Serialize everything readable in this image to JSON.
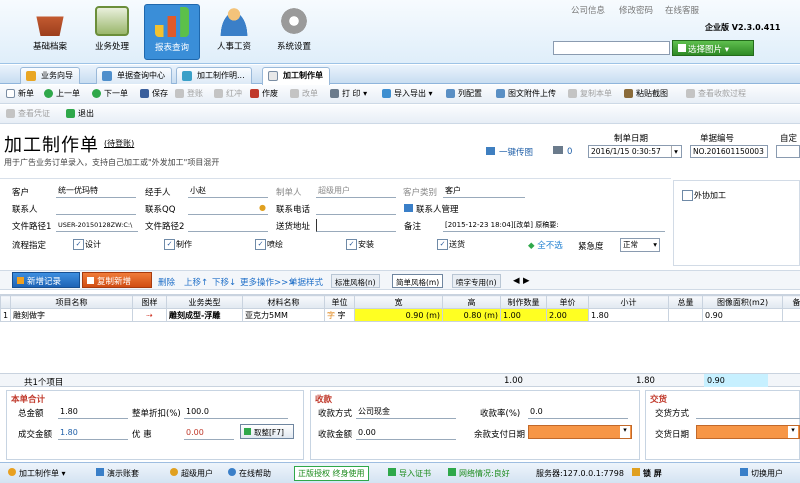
{
  "header": {
    "nav": [
      {
        "label": "基础档案",
        "icon": "basket-icon",
        "color": "#b5542f"
      },
      {
        "label": "业务处理",
        "icon": "calculator-icon",
        "color": "#6b8e3a"
      },
      {
        "label": "报表查询",
        "icon": "bar-chart-icon",
        "color": "#e0a020"
      },
      {
        "label": "人事工资",
        "icon": "person-icon",
        "color": "#3a7fc8"
      },
      {
        "label": "系统设置",
        "icon": "gear-icon",
        "color": "#8a8a8a"
      }
    ],
    "links": [
      "公司信息",
      "修改密码",
      "在线客服"
    ],
    "edition": "企业版 V2.3.0.411",
    "select_image_label": "选择图片"
  },
  "tabs": [
    "业务向导",
    "单据查询中心",
    "加工制作明...",
    "加工制作单"
  ],
  "toolbar1": [
    {
      "label": "新单",
      "enabled": true
    },
    {
      "label": "上一单",
      "enabled": true
    },
    {
      "label": "下一单",
      "enabled": true
    },
    {
      "label": "保存",
      "enabled": true
    },
    {
      "label": "登账",
      "enabled": false
    },
    {
      "label": "红冲",
      "enabled": false
    },
    {
      "label": "作废",
      "enabled": true
    },
    {
      "label": "改单",
      "enabled": false
    },
    {
      "label": "打 印",
      "enabled": true
    },
    {
      "label": "导入导出",
      "enabled": true
    },
    {
      "label": "列配置",
      "enabled": true
    },
    {
      "label": "图文附件上传",
      "enabled": true
    },
    {
      "label": "复制本单",
      "enabled": false
    },
    {
      "label": "粘贴截图",
      "enabled": true
    },
    {
      "label": "查看收款过程",
      "enabled": false
    }
  ],
  "toolbar2": [
    {
      "label": "查看凭证",
      "enabled": false
    },
    {
      "label": "退出",
      "enabled": true
    }
  ],
  "doc": {
    "title": "加工制作单",
    "status": "(待登账)",
    "subtitle": "用于广告业务订单录入，支持自己加工或\"外发加工\"项目混开",
    "upload_label": "一键传图",
    "print_count": "0",
    "date_label": "制单日期",
    "date_value": "2016/1/15 0:30:57",
    "number_label": "单据编号",
    "number_value": "NO.201601150003",
    "custom_label": "自定"
  },
  "form": {
    "customer_label": "客户",
    "customer_value": "统一优玛特",
    "handler_label": "经手人",
    "handler_value": "小赵",
    "maker_label": "制单人",
    "maker_value": "超级用户",
    "cust_type_label": "客户类别",
    "cust_type_value": "客户",
    "contact_label": "联系人",
    "qq_label": "联系QQ",
    "phone_label": "联系电话",
    "contact_mgr_label": "联系人管理",
    "path1_label": "文件路径1",
    "path1_value": "USER-20150128ZW:C:\\",
    "path2_label": "文件路径2",
    "addr_label": "送货地址",
    "note_label": "备注",
    "note_value": "[2015-12-23 18:04][改单]  原稿要:",
    "outsource_label": "外协加工",
    "flow_label": "流程指定",
    "flow": [
      "设计",
      "制作",
      "喷绘",
      "安装",
      "送货"
    ],
    "select_none_label": "全不选",
    "urgency_label": "紧急度",
    "urgency_value": "正常"
  },
  "grid_toolbar": {
    "add_row": "新增记录",
    "copy_row": "复制新增",
    "delete": "删除",
    "move_up": "上移↑",
    "move_down": "下移↓",
    "more": "更多操作>>>",
    "style": "单据样式",
    "style_tabs": [
      "标准风格(n)",
      "简单风格(m)",
      "喷字专用(n)"
    ]
  },
  "grid": {
    "columns": [
      "",
      "项目名称",
      "图样",
      "业务类型",
      "材料名称",
      "单位",
      "宽",
      "高",
      "制作数量",
      "单价",
      "小计",
      "总量",
      "图像面积(m2)",
      "备"
    ],
    "rows": [
      [
        "1",
        "雕刻做字",
        "⇢",
        "雕刻成型-浮雕",
        "亚克力5MM",
        "字",
        "0.90 (m)",
        "0.80 (m)",
        "1.00",
        "2.00",
        "1.80",
        "",
        "0.90",
        ""
      ]
    ],
    "footer_label": "共1个项目",
    "footer_qty": "1.00",
    "footer_subtotal": "1.80",
    "footer_area": "0.90"
  },
  "totals": {
    "title": "本单合计",
    "total_label": "总金额",
    "total_value": "1.80",
    "discount_label": "整单折扣(%)",
    "discount_value": "100.0",
    "deal_label": "成交金额",
    "deal_value": "1.80",
    "benefit_label": "优  惠",
    "benefit_value": "0.00",
    "pay_button": "取整[F7]"
  },
  "receipt": {
    "title": "收款",
    "method_label": "收款方式",
    "method_value": "公司现金",
    "amount_label": "收款金额",
    "amount_value": "0.00",
    "rate_label": "收款率(%)",
    "rate_value": "0.0",
    "due_label": "余款支付日期"
  },
  "delivery": {
    "title": "交货",
    "method_label": "交货方式",
    "date_label": "交货日期"
  },
  "status": {
    "menu": "加工制作单",
    "demo": "演示账套",
    "user": "超级用户",
    "help": "在线帮助",
    "license": "正版授权 终身使用",
    "import_cert": "导入证书",
    "network": "网络情况:良好",
    "server": "服务器:127.0.0.1:7798",
    "lock": "锁 屏",
    "switch": "切换用户"
  }
}
